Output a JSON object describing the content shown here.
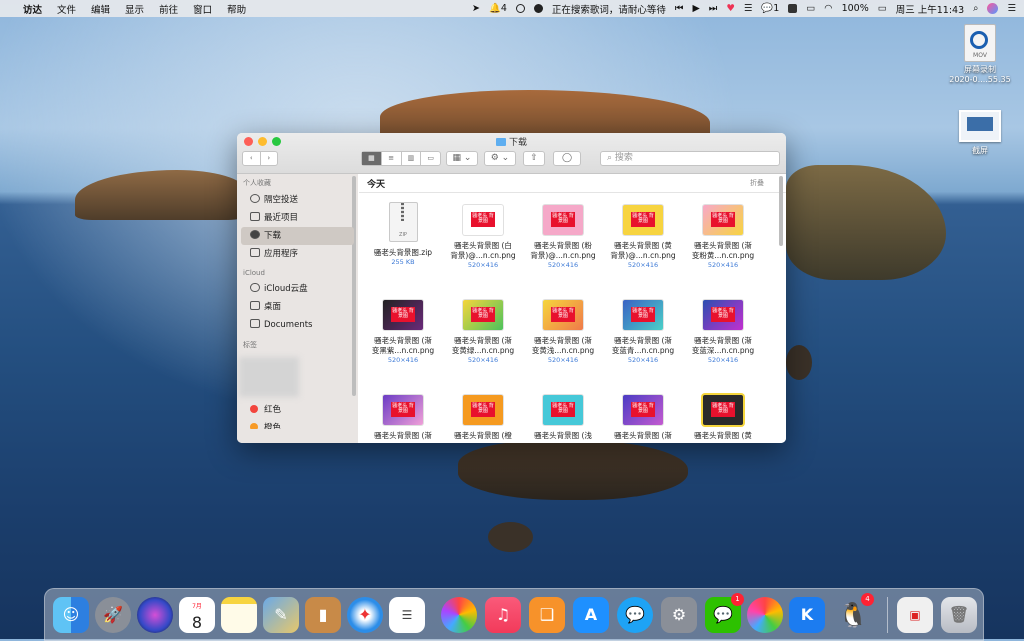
{
  "menubar": {
    "apple": "",
    "items": [
      "访达",
      "文件",
      "编辑",
      "显示",
      "前往",
      "窗口",
      "帮助"
    ],
    "bell_count": "4",
    "status_text": "正在搜索歌词，请耐心等待",
    "wechat_count": "1",
    "battery": "100%",
    "clock": "周三 上午11:43"
  },
  "desktop": {
    "recording_tag": "MOV",
    "recording_name_1": "屏幕录制",
    "recording_name_2": "2020-0....55.35",
    "screenshot_name": "截屏"
  },
  "finder": {
    "title": "下载",
    "search_placeholder": "搜索",
    "sidebar": {
      "favorites_head": "个人收藏",
      "favorites": [
        "隔空投送",
        "最近项目",
        "下载",
        "应用程序"
      ],
      "icloud_head": "iCloud",
      "icloud": [
        "iCloud云盘",
        "桌面",
        "Documents"
      ],
      "tags_head": "标签",
      "tags": [
        "红色",
        "橙色"
      ]
    },
    "section_title": "今天",
    "section_toggle": "折叠",
    "files": [
      {
        "name1": "骚老头背景图.zip",
        "name2": "",
        "meta": "255 KB"
      },
      {
        "name1": "骚老头背景图 (白",
        "name2": "背景)@...n.cn.png",
        "meta": "520×416"
      },
      {
        "name1": "骚老头背景图 (粉",
        "name2": "背景)@...n.cn.png",
        "meta": "520×416"
      },
      {
        "name1": "骚老头背景图 (黄",
        "name2": "背景)@...n.cn.png",
        "meta": "520×416"
      },
      {
        "name1": "骚老头背景图 (渐",
        "name2": "变粉黄...n.cn.png",
        "meta": "520×416"
      },
      {
        "name1": "骚老头背景图 (渐",
        "name2": "变黑紫...n.cn.png",
        "meta": "520×416"
      },
      {
        "name1": "骚老头背景图 (渐",
        "name2": "变黄绿...n.cn.png",
        "meta": "520×416"
      },
      {
        "name1": "骚老头背景图 (渐",
        "name2": "变黄浅...n.cn.png",
        "meta": "520×416"
      },
      {
        "name1": "骚老头背景图 (渐",
        "name2": "变蓝青...n.cn.png",
        "meta": "520×416"
      },
      {
        "name1": "骚老头背景图 (渐",
        "name2": "变蓝深...n.cn.png",
        "meta": "520×416"
      },
      {
        "name1": "骚老头背景图 (渐",
        "name2": "",
        "meta": ""
      },
      {
        "name1": "骚老头背景图 (橙",
        "name2": "",
        "meta": ""
      },
      {
        "name1": "骚老头背景图 (浅",
        "name2": "",
        "meta": ""
      },
      {
        "name1": "骚老头背景图 (渐",
        "name2": "",
        "meta": ""
      },
      {
        "name1": "骚老头背景图 (黄",
        "name2": "",
        "meta": ""
      }
    ],
    "thumb_text": "骚老头 背景图"
  },
  "dock": {
    "calendar_month": "7月",
    "calendar_day": "8",
    "wechat_badge": "1",
    "qq_badge": "4"
  },
  "colors": {
    "accent": "#3d7ad6",
    "close": "#fd5f57",
    "minimize": "#febc2e",
    "maximize": "#28c840"
  }
}
